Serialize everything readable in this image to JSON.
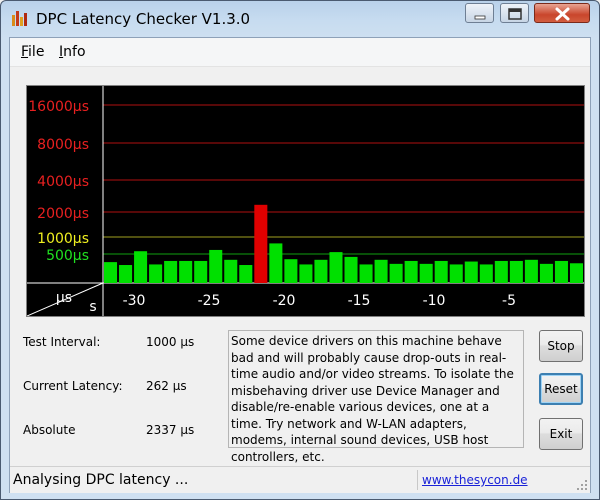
{
  "window": {
    "title": "DPC Latency Checker V1.3.0"
  },
  "menu": {
    "items": [
      {
        "label": "File",
        "underline": "F"
      },
      {
        "label": "Info",
        "underline": "I"
      }
    ]
  },
  "graph": {
    "y_labels": [
      {
        "text": "16000µs",
        "color": "#e82020",
        "line_color": "#b01010"
      },
      {
        "text": "8000µs",
        "color": "#e82020",
        "line_color": "#b01010"
      },
      {
        "text": "4000µs",
        "color": "#e82020",
        "line_color": "#b01010"
      },
      {
        "text": "2000µs",
        "color": "#e82020",
        "line_color": "#b01010"
      },
      {
        "text": "1000µs",
        "color": "#f0f020",
        "line_color": "#a0a020"
      },
      {
        "text": "500µs",
        "color": "#20e020",
        "line_color": "#10a010"
      }
    ],
    "unit_y": "µs",
    "unit_x": "s",
    "x_labels": [
      "-30",
      "-25",
      "-20",
      "-15",
      "-10",
      "-5"
    ]
  },
  "chart_data": {
    "type": "bar",
    "ylabel": "µs",
    "xlabel": "s",
    "yscale": "log",
    "y_ticks": [
      500,
      1000,
      2000,
      4000,
      8000,
      16000
    ],
    "x_ticks": [
      -30,
      -25,
      -20,
      -15,
      -10,
      -5
    ],
    "bar_good_color": "#00e000",
    "bar_bad_color": "#e00000",
    "values": [
      360,
      310,
      560,
      320,
      380,
      380,
      380,
      590,
      400,
      310,
      2337,
      770,
      410,
      320,
      400,
      540,
      450,
      320,
      400,
      330,
      380,
      330,
      380,
      320,
      370,
      320,
      380,
      380,
      400,
      330,
      380,
      340
    ]
  },
  "info": {
    "test_interval_label": "Test Interval:",
    "test_interval_value": "1000 µs",
    "current_latency_label": "Current Latency:",
    "current_latency_value": "262 µs",
    "absolute_label": "Absolute",
    "absolute_value": "2337 µs",
    "message": "Some device drivers on this machine behave bad and will probably cause drop-outs in real-time audio and/or video streams. To isolate the misbehaving driver use Device Manager and disable/re-enable various devices, one at a time. Try network and W-LAN adapters, modems, internal sound devices, USB host controllers, etc."
  },
  "buttons": {
    "stop": "Stop",
    "reset": "Reset",
    "exit": "Exit"
  },
  "status": {
    "text": "Analysing DPC latency ...",
    "link": "www.thesycon.de"
  }
}
